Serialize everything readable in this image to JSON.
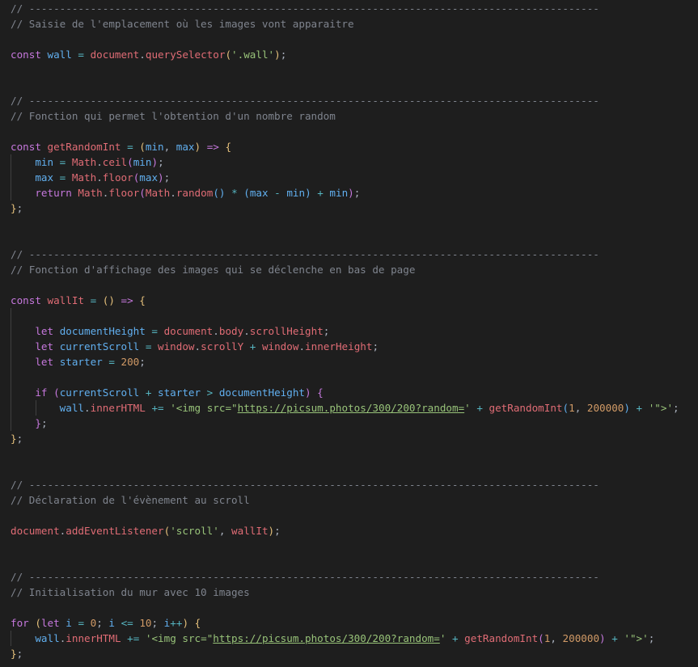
{
  "editor": {
    "lines": [
      {
        "indent": 0,
        "tokens": [
          {
            "t": "// ---------------------------------------------------------------------------------------------",
            "c": "t-com"
          }
        ]
      },
      {
        "indent": 0,
        "tokens": [
          {
            "t": "// Saisie de l'emplacement où les images vont apparaitre",
            "c": "t-com"
          }
        ]
      },
      {
        "indent": 0,
        "tokens": []
      },
      {
        "indent": 0,
        "tokens": [
          {
            "t": "const ",
            "c": "t-purple"
          },
          {
            "t": "wall",
            "c": "t-blue"
          },
          {
            "t": " = ",
            "c": "t-teal"
          },
          {
            "t": "document",
            "c": "t-red"
          },
          {
            "t": ".",
            "c": "t-gray"
          },
          {
            "t": "querySelector",
            "c": "t-red"
          },
          {
            "t": "(",
            "c": "t-yellow"
          },
          {
            "t": "'.wall'",
            "c": "t-green"
          },
          {
            "t": ")",
            "c": "t-yellow"
          },
          {
            "t": ";",
            "c": "t-gray"
          }
        ]
      },
      {
        "indent": 0,
        "tokens": []
      },
      {
        "indent": 0,
        "tokens": []
      },
      {
        "indent": 0,
        "tokens": [
          {
            "t": "// ---------------------------------------------------------------------------------------------",
            "c": "t-com"
          }
        ]
      },
      {
        "indent": 0,
        "tokens": [
          {
            "t": "// Fonction qui permet l'obtention d'un nombre random",
            "c": "t-com"
          }
        ]
      },
      {
        "indent": 0,
        "tokens": []
      },
      {
        "indent": 0,
        "tokens": [
          {
            "t": "const ",
            "c": "t-purple"
          },
          {
            "t": "getRandomInt",
            "c": "t-red"
          },
          {
            "t": " = ",
            "c": "t-teal"
          },
          {
            "t": "(",
            "c": "t-yellow"
          },
          {
            "t": "min",
            "c": "t-blue"
          },
          {
            "t": ", ",
            "c": "t-gray"
          },
          {
            "t": "max",
            "c": "t-blue"
          },
          {
            "t": ")",
            "c": "t-yellow"
          },
          {
            "t": " => ",
            "c": "t-purple"
          },
          {
            "t": "{",
            "c": "t-yellow"
          }
        ]
      },
      {
        "indent": 1,
        "tokens": [
          {
            "t": "min",
            "c": "t-blue"
          },
          {
            "t": " = ",
            "c": "t-teal"
          },
          {
            "t": "Math",
            "c": "t-red"
          },
          {
            "t": ".",
            "c": "t-gray"
          },
          {
            "t": "ceil",
            "c": "t-red"
          },
          {
            "t": "(",
            "c": "t-purple"
          },
          {
            "t": "min",
            "c": "t-blue"
          },
          {
            "t": ")",
            "c": "t-purple"
          },
          {
            "t": ";",
            "c": "t-gray"
          }
        ]
      },
      {
        "indent": 1,
        "tokens": [
          {
            "t": "max",
            "c": "t-blue"
          },
          {
            "t": " = ",
            "c": "t-teal"
          },
          {
            "t": "Math",
            "c": "t-red"
          },
          {
            "t": ".",
            "c": "t-gray"
          },
          {
            "t": "floor",
            "c": "t-red"
          },
          {
            "t": "(",
            "c": "t-purple"
          },
          {
            "t": "max",
            "c": "t-blue"
          },
          {
            "t": ")",
            "c": "t-purple"
          },
          {
            "t": ";",
            "c": "t-gray"
          }
        ]
      },
      {
        "indent": 1,
        "tokens": [
          {
            "t": "return ",
            "c": "t-purple"
          },
          {
            "t": "Math",
            "c": "t-red"
          },
          {
            "t": ".",
            "c": "t-gray"
          },
          {
            "t": "floor",
            "c": "t-red"
          },
          {
            "t": "(",
            "c": "t-purple"
          },
          {
            "t": "Math",
            "c": "t-red"
          },
          {
            "t": ".",
            "c": "t-gray"
          },
          {
            "t": "random",
            "c": "t-red"
          },
          {
            "t": "()",
            "c": "t-blue"
          },
          {
            "t": " * ",
            "c": "t-teal"
          },
          {
            "t": "(",
            "c": "t-blue"
          },
          {
            "t": "max",
            "c": "t-blue"
          },
          {
            "t": " - ",
            "c": "t-teal"
          },
          {
            "t": "min",
            "c": "t-blue"
          },
          {
            "t": ")",
            "c": "t-blue"
          },
          {
            "t": " + ",
            "c": "t-teal"
          },
          {
            "t": "min",
            "c": "t-blue"
          },
          {
            "t": ")",
            "c": "t-purple"
          },
          {
            "t": ";",
            "c": "t-gray"
          }
        ]
      },
      {
        "indent": 0,
        "tokens": [
          {
            "t": "}",
            "c": "t-yellow"
          },
          {
            "t": ";",
            "c": "t-gray"
          }
        ]
      },
      {
        "indent": 0,
        "tokens": []
      },
      {
        "indent": 0,
        "tokens": []
      },
      {
        "indent": 0,
        "tokens": [
          {
            "t": "// ---------------------------------------------------------------------------------------------",
            "c": "t-com"
          }
        ]
      },
      {
        "indent": 0,
        "tokens": [
          {
            "t": "// Fonction d'affichage des images qui se déclenche en bas de page",
            "c": "t-com"
          }
        ]
      },
      {
        "indent": 0,
        "tokens": []
      },
      {
        "indent": 0,
        "tokens": [
          {
            "t": "const ",
            "c": "t-purple"
          },
          {
            "t": "wallIt",
            "c": "t-red"
          },
          {
            "t": " = ",
            "c": "t-teal"
          },
          {
            "t": "()",
            "c": "t-yellow"
          },
          {
            "t": " => ",
            "c": "t-purple"
          },
          {
            "t": "{",
            "c": "t-yellow"
          }
        ]
      },
      {
        "indent": 1,
        "tokens": []
      },
      {
        "indent": 1,
        "tokens": [
          {
            "t": "let ",
            "c": "t-purple"
          },
          {
            "t": "documentHeight",
            "c": "t-blue"
          },
          {
            "t": " = ",
            "c": "t-teal"
          },
          {
            "t": "document",
            "c": "t-red"
          },
          {
            "t": ".",
            "c": "t-gray"
          },
          {
            "t": "body",
            "c": "t-red"
          },
          {
            "t": ".",
            "c": "t-gray"
          },
          {
            "t": "scrollHeight",
            "c": "t-red"
          },
          {
            "t": ";",
            "c": "t-gray"
          }
        ]
      },
      {
        "indent": 1,
        "tokens": [
          {
            "t": "let ",
            "c": "t-purple"
          },
          {
            "t": "currentScroll",
            "c": "t-blue"
          },
          {
            "t": " = ",
            "c": "t-teal"
          },
          {
            "t": "window",
            "c": "t-red"
          },
          {
            "t": ".",
            "c": "t-gray"
          },
          {
            "t": "scrollY",
            "c": "t-red"
          },
          {
            "t": " + ",
            "c": "t-teal"
          },
          {
            "t": "window",
            "c": "t-red"
          },
          {
            "t": ".",
            "c": "t-gray"
          },
          {
            "t": "innerHeight",
            "c": "t-red"
          },
          {
            "t": ";",
            "c": "t-gray"
          }
        ]
      },
      {
        "indent": 1,
        "tokens": [
          {
            "t": "let ",
            "c": "t-purple"
          },
          {
            "t": "starter",
            "c": "t-blue"
          },
          {
            "t": " = ",
            "c": "t-teal"
          },
          {
            "t": "200",
            "c": "t-num"
          },
          {
            "t": ";",
            "c": "t-gray"
          }
        ]
      },
      {
        "indent": 1,
        "tokens": []
      },
      {
        "indent": 1,
        "tokens": [
          {
            "t": "if ",
            "c": "t-purple"
          },
          {
            "t": "(",
            "c": "t-purple"
          },
          {
            "t": "currentScroll",
            "c": "t-blue"
          },
          {
            "t": " + ",
            "c": "t-teal"
          },
          {
            "t": "starter",
            "c": "t-blue"
          },
          {
            "t": " > ",
            "c": "t-teal"
          },
          {
            "t": "documentHeight",
            "c": "t-blue"
          },
          {
            "t": ")",
            "c": "t-purple"
          },
          {
            "t": " {",
            "c": "t-purple"
          }
        ]
      },
      {
        "indent": 2,
        "tokens": [
          {
            "t": "wall",
            "c": "t-blue"
          },
          {
            "t": ".",
            "c": "t-gray"
          },
          {
            "t": "innerHTML",
            "c": "t-red"
          },
          {
            "t": " += ",
            "c": "t-teal"
          },
          {
            "t": "'<img src=\"",
            "c": "t-green"
          },
          {
            "t": "https://picsum.photos/300/200?random=",
            "c": "t-green",
            "u": true
          },
          {
            "t": "'",
            "c": "t-green"
          },
          {
            "t": " + ",
            "c": "t-teal"
          },
          {
            "t": "getRandomInt",
            "c": "t-red"
          },
          {
            "t": "(",
            "c": "t-blue"
          },
          {
            "t": "1",
            "c": "t-num"
          },
          {
            "t": ", ",
            "c": "t-gray"
          },
          {
            "t": "200000",
            "c": "t-num"
          },
          {
            "t": ")",
            "c": "t-blue"
          },
          {
            "t": " + ",
            "c": "t-teal"
          },
          {
            "t": "'\">'",
            "c": "t-green"
          },
          {
            "t": ";",
            "c": "t-gray"
          }
        ]
      },
      {
        "indent": 1,
        "tokens": [
          {
            "t": "}",
            "c": "t-purple"
          },
          {
            "t": ";",
            "c": "t-gray"
          }
        ]
      },
      {
        "indent": 0,
        "tokens": [
          {
            "t": "}",
            "c": "t-yellow"
          },
          {
            "t": ";",
            "c": "t-gray"
          }
        ]
      },
      {
        "indent": 0,
        "tokens": []
      },
      {
        "indent": 0,
        "tokens": []
      },
      {
        "indent": 0,
        "tokens": [
          {
            "t": "// ---------------------------------------------------------------------------------------------",
            "c": "t-com"
          }
        ]
      },
      {
        "indent": 0,
        "tokens": [
          {
            "t": "// Déclaration de l'évènement au scroll",
            "c": "t-com"
          }
        ]
      },
      {
        "indent": 0,
        "tokens": []
      },
      {
        "indent": 0,
        "tokens": [
          {
            "t": "document",
            "c": "t-red"
          },
          {
            "t": ".",
            "c": "t-gray"
          },
          {
            "t": "addEventListener",
            "c": "t-red"
          },
          {
            "t": "(",
            "c": "t-yellow"
          },
          {
            "t": "'scroll'",
            "c": "t-green"
          },
          {
            "t": ", ",
            "c": "t-gray"
          },
          {
            "t": "wallIt",
            "c": "t-red"
          },
          {
            "t": ")",
            "c": "t-yellow"
          },
          {
            "t": ";",
            "c": "t-gray"
          }
        ]
      },
      {
        "indent": 0,
        "tokens": []
      },
      {
        "indent": 0,
        "tokens": []
      },
      {
        "indent": 0,
        "tokens": [
          {
            "t": "// ---------------------------------------------------------------------------------------------",
            "c": "t-com"
          }
        ]
      },
      {
        "indent": 0,
        "tokens": [
          {
            "t": "// Initialisation du mur avec 10 images",
            "c": "t-com"
          }
        ]
      },
      {
        "indent": 0,
        "tokens": []
      },
      {
        "indent": 0,
        "tokens": [
          {
            "t": "for ",
            "c": "t-purple"
          },
          {
            "t": "(",
            "c": "t-yellow"
          },
          {
            "t": "let ",
            "c": "t-purple"
          },
          {
            "t": "i",
            "c": "t-blue"
          },
          {
            "t": " = ",
            "c": "t-teal"
          },
          {
            "t": "0",
            "c": "t-num"
          },
          {
            "t": "; ",
            "c": "t-gray"
          },
          {
            "t": "i",
            "c": "t-blue"
          },
          {
            "t": " <= ",
            "c": "t-teal"
          },
          {
            "t": "10",
            "c": "t-num"
          },
          {
            "t": "; ",
            "c": "t-gray"
          },
          {
            "t": "i",
            "c": "t-blue"
          },
          {
            "t": "++",
            "c": "t-teal"
          },
          {
            "t": ")",
            "c": "t-yellow"
          },
          {
            "t": " {",
            "c": "t-yellow"
          }
        ]
      },
      {
        "indent": 1,
        "tokens": [
          {
            "t": "wall",
            "c": "t-blue"
          },
          {
            "t": ".",
            "c": "t-gray"
          },
          {
            "t": "innerHTML",
            "c": "t-red"
          },
          {
            "t": " += ",
            "c": "t-teal"
          },
          {
            "t": "'<img src=\"",
            "c": "t-green"
          },
          {
            "t": "https://picsum.photos/300/200?random=",
            "c": "t-green",
            "u": true
          },
          {
            "t": "'",
            "c": "t-green"
          },
          {
            "t": " + ",
            "c": "t-teal"
          },
          {
            "t": "getRandomInt",
            "c": "t-red"
          },
          {
            "t": "(",
            "c": "t-purple"
          },
          {
            "t": "1",
            "c": "t-num"
          },
          {
            "t": ", ",
            "c": "t-gray"
          },
          {
            "t": "200000",
            "c": "t-num"
          },
          {
            "t": ")",
            "c": "t-purple"
          },
          {
            "t": " + ",
            "c": "t-teal"
          },
          {
            "t": "'\">'",
            "c": "t-green"
          },
          {
            "t": ";",
            "c": "t-gray"
          }
        ]
      },
      {
        "indent": 0,
        "tokens": [
          {
            "t": "}",
            "c": "t-yellow"
          },
          {
            "t": ";",
            "c": "t-gray"
          }
        ]
      }
    ]
  }
}
